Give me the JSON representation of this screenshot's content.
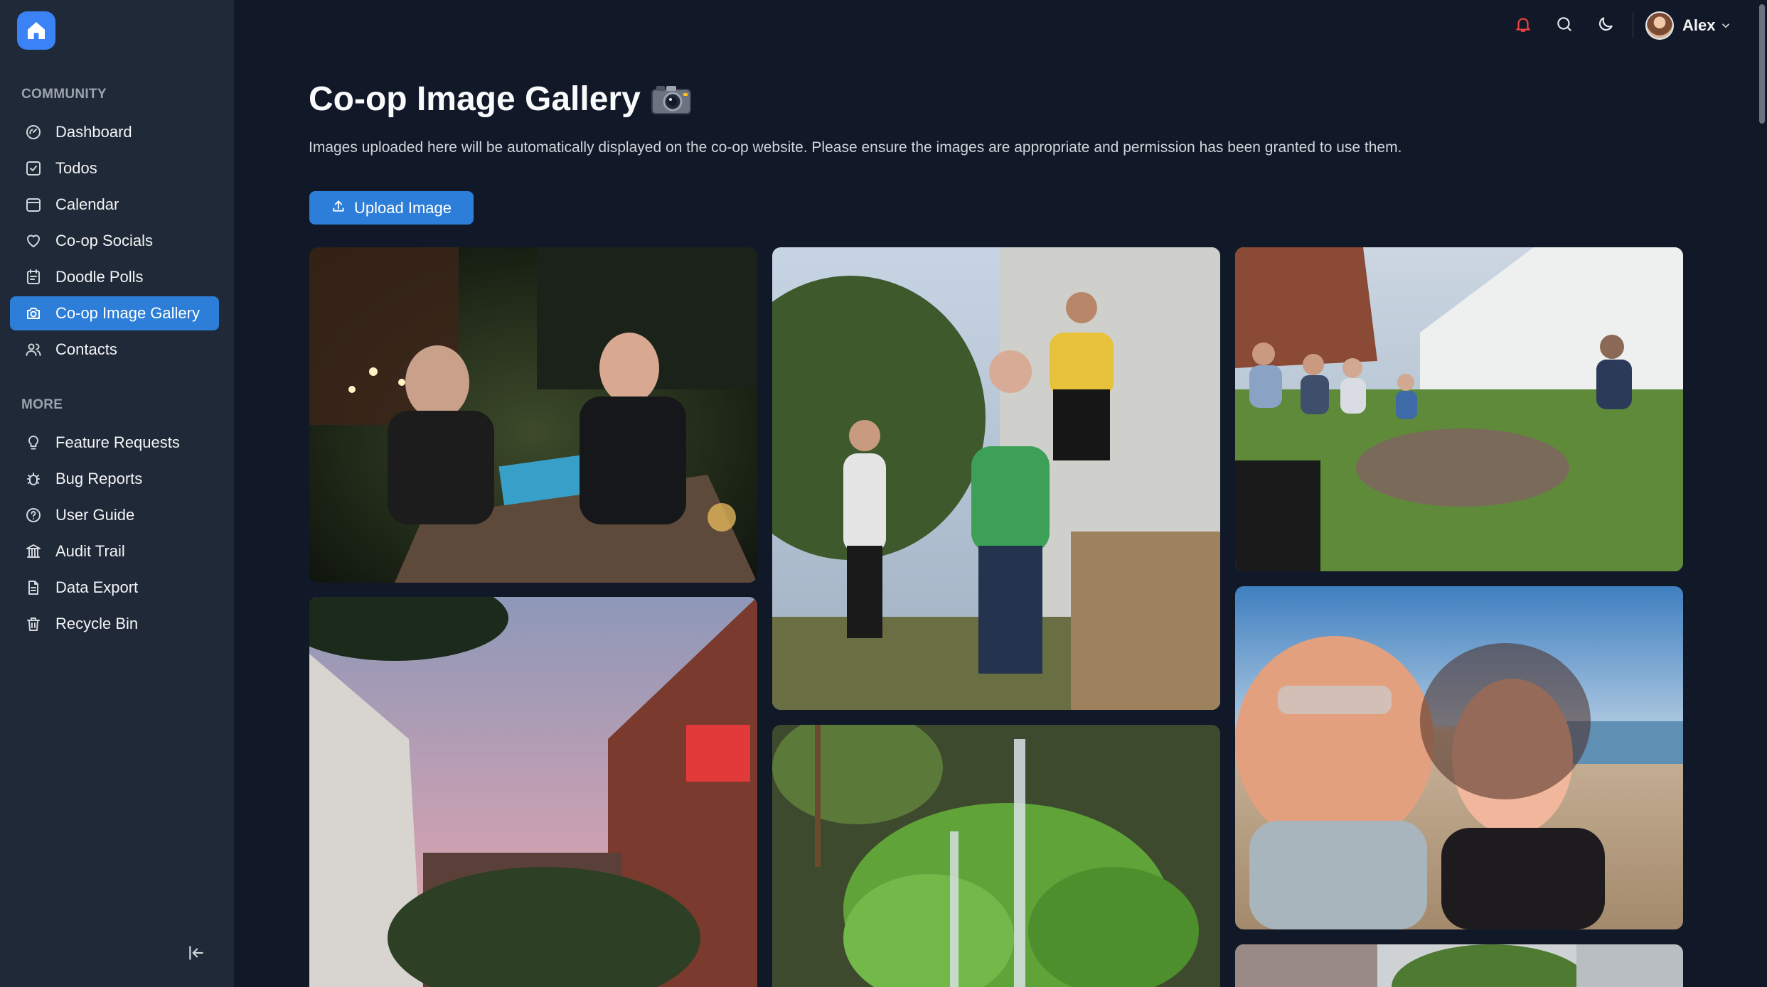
{
  "sidebar": {
    "sections": [
      {
        "label": "COMMUNITY",
        "items": [
          {
            "label": "Dashboard",
            "icon": "dashboard-icon"
          },
          {
            "label": "Todos",
            "icon": "checkbox-icon"
          },
          {
            "label": "Calendar",
            "icon": "calendar-icon"
          },
          {
            "label": "Co-op Socials",
            "icon": "heart-icon"
          },
          {
            "label": "Doodle Polls",
            "icon": "poll-icon"
          },
          {
            "label": "Co-op Image Gallery",
            "icon": "camera-icon",
            "active": true
          },
          {
            "label": "Contacts",
            "icon": "users-icon"
          }
        ]
      },
      {
        "label": "MORE",
        "items": [
          {
            "label": "Feature Requests",
            "icon": "lightbulb-icon"
          },
          {
            "label": "Bug Reports",
            "icon": "bug-icon"
          },
          {
            "label": "User Guide",
            "icon": "help-circle-icon"
          },
          {
            "label": "Audit Trail",
            "icon": "audit-icon"
          },
          {
            "label": "Data Export",
            "icon": "file-icon"
          },
          {
            "label": "Recycle Bin",
            "icon": "trash-icon"
          }
        ]
      }
    ],
    "collapse_icon": "collapse-sidebar-icon"
  },
  "header": {
    "icons": [
      "bell-icon",
      "search-icon",
      "moon-icon"
    ],
    "user_name": "Alex",
    "notification_color": "#ef4444"
  },
  "main": {
    "title": "Co-op Image Gallery",
    "title_emoji": "camera-emoji",
    "description": "Images uploaded here will be automatically displayed on the co-op website. Please ensure the images are appropriate and permission has been granted to use them.",
    "upload_label": "Upload Image"
  },
  "gallery": {
    "images": [
      {
        "subject": "night-garden-table-photo"
      },
      {
        "subject": "garden-group-standing-photo"
      },
      {
        "subject": "group-seated-around-firepit-photo"
      },
      {
        "subject": "pink-sky-building-photo"
      },
      {
        "subject": "squash-plant-photo"
      },
      {
        "subject": "beach-selfie-photo"
      },
      {
        "subject": "partial-garden-photo"
      }
    ]
  },
  "colors": {
    "background": "#111827",
    "sidebar": "#1f2937",
    "accent": "#2d7ed8"
  }
}
